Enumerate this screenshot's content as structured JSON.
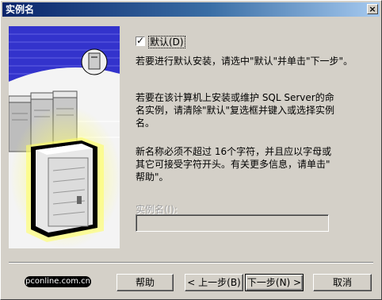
{
  "window": {
    "title": "实例名",
    "close_label": "×"
  },
  "checkbox": {
    "label": "默认(D)",
    "checked": true,
    "mark": "✓"
  },
  "paragraphs": {
    "p1": "若要进行默认安装，请选中\"默认\"并单击\"下一步\"。",
    "p2_line1": "若要在该计算机上安装或维护 SQL Server的命",
    "p2_line2": "名实例，请清除\"默认\"复选框并键入或选择实例",
    "p2_line3": "名。",
    "p3_line1": "新名称必须不超过 16个字符，并且应以字母或",
    "p3_line2": "其它可接受字符开头。有关更多信息，请单击\"",
    "p3_line3": "帮助\"。"
  },
  "instance_name": {
    "label": "实例名(I):",
    "value": ""
  },
  "watermark": "pconline.com.cn",
  "buttons": {
    "help": "帮助",
    "back": "< 上一步(B)",
    "next": "下一步(N) >",
    "cancel": "取消"
  },
  "colors": {
    "titlebar_start": "#0a246a",
    "titlebar_end": "#a6caf0",
    "face": "#d4d0c8",
    "art_blue": "#3333cc"
  }
}
